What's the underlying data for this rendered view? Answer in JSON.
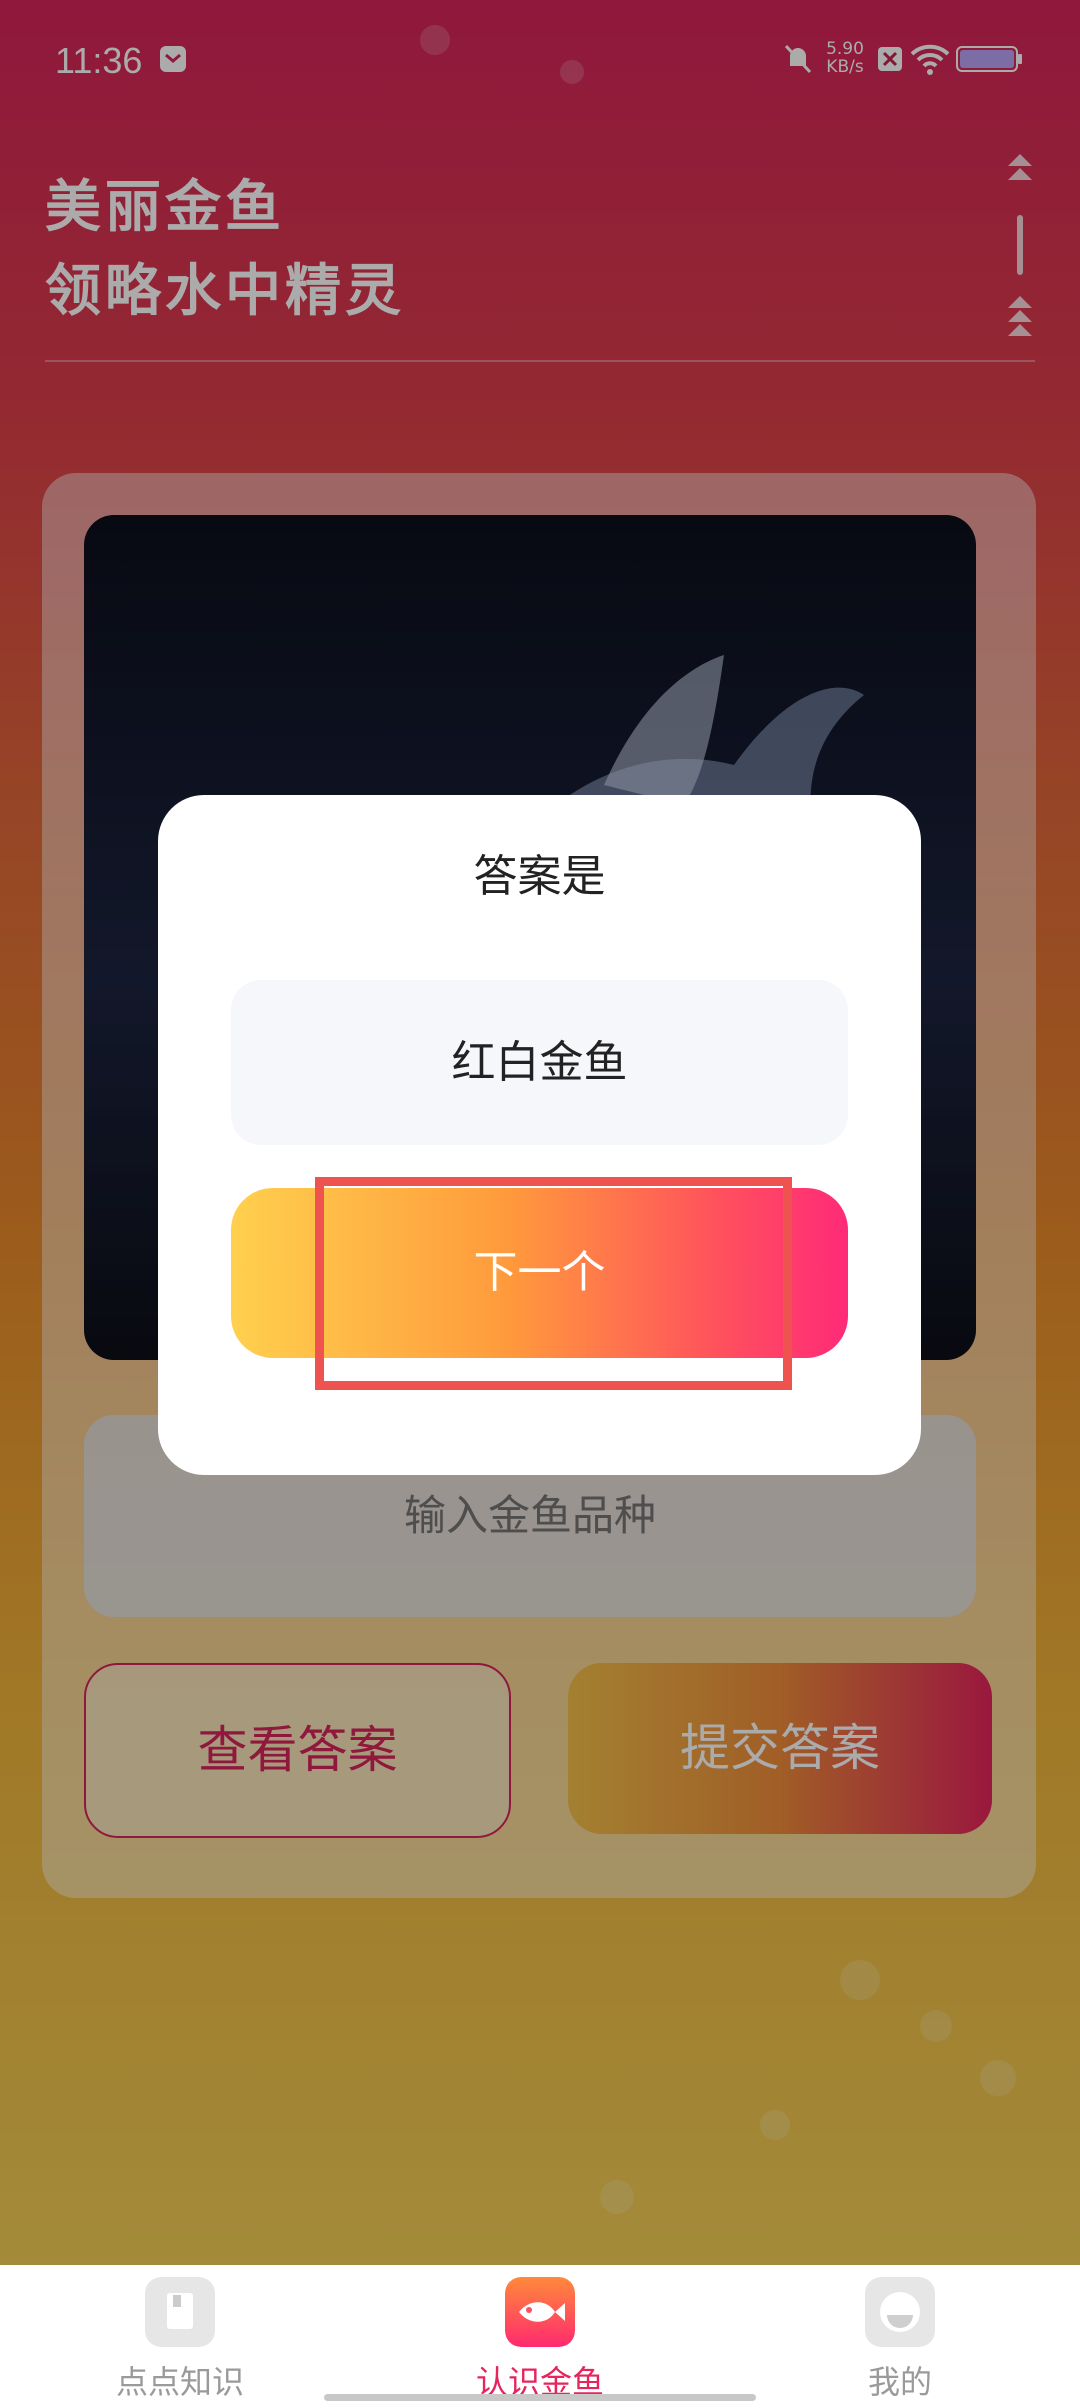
{
  "status_bar": {
    "time": "11:36",
    "net_speed_value": "5.90",
    "net_speed_unit": "KB/s"
  },
  "header": {
    "line1": "美丽金鱼",
    "line2": "领略水中精灵"
  },
  "quiz": {
    "input_placeholder": "输入金鱼品种",
    "view_answer_label": "查看答案",
    "submit_answer_label": "提交答案"
  },
  "dialog": {
    "title": "答案是",
    "answer": "红白金鱼",
    "next_label": "下一个"
  },
  "tabs": [
    {
      "label": "点点知识",
      "icon": "book-icon",
      "active": false
    },
    {
      "label": "认识金鱼",
      "icon": "fish-icon",
      "active": true
    },
    {
      "label": "我的",
      "icon": "profile-icon",
      "active": false
    }
  ],
  "colors": {
    "accent": "#ff3a6e",
    "active_tab": "#e6245e",
    "inactive_tab": "#9a9a9a",
    "highlight": "#ef5350"
  }
}
